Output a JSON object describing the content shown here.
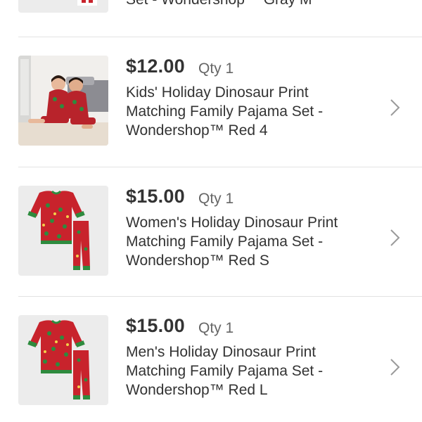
{
  "top_partial": {
    "desc_line": "Set - Wondershop™ Gray M"
  },
  "items": [
    {
      "price": "$12.00",
      "qty": "Qty 1",
      "desc_lines": [
        "Kids' Holiday Dinosaur Print",
        "Matching Family Pajama Set -",
        "Wondershop™ Red 4"
      ],
      "thumb_icon": "kids-photo-thumbnail"
    },
    {
      "price": "$15.00",
      "qty": "Qty 1",
      "desc_lines": [
        "Women's Holiday Dinosaur Print",
        "Matching Family Pajama Set -",
        "Wondershop™ Red S"
      ],
      "thumb_icon": "pajama-thumbnail"
    },
    {
      "price": "$15.00",
      "qty": "Qty 1",
      "desc_lines": [
        "Men's Holiday Dinosaur Print",
        "Matching Family Pajama Set -",
        "Wondershop™ Red L"
      ],
      "thumb_icon": "pajama-thumbnail"
    }
  ],
  "colors": {
    "pajama_red": "#c8232c",
    "cuff_green": "#2e8b3e",
    "chevron": "#9a9a9a",
    "divider": "#e3e3e3"
  }
}
